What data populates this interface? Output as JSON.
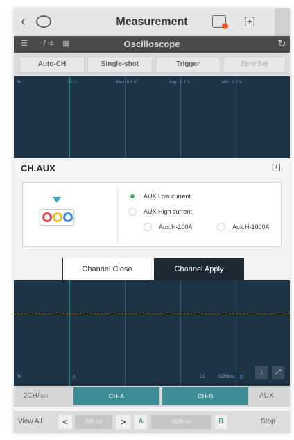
{
  "app": {
    "title": "Measurement",
    "back_icon": "chevron-left-icon",
    "logo_icon": "brand-logo-icon",
    "vci_icon": "vci-status-icon",
    "expand_icon": "fullscreen-icon",
    "more_icon": "more-icon"
  },
  "toolbar": {
    "title": "Oscilloscope",
    "icons": [
      "settings-sliders-icon",
      "measure-icon",
      "chart-icon",
      "refresh-icon"
    ]
  },
  "modes": {
    "auto": "Auto-CH",
    "single": "Single-shot",
    "trigger": "Trigger",
    "zero": "Zero Set"
  },
  "scope_top": {
    "volt_label": "0V",
    "channel_label": "CH-A",
    "max_label": "Max: 0.1 V",
    "avg_label": "Avg: -0.1 V",
    "min_label": "Min: -0.2 V"
  },
  "dialog": {
    "title": "CH.AUX",
    "options": {
      "aux_low": "AUX Low current",
      "aux_high": "AUX High current",
      "h100": "Aux.H-100A",
      "h1000": "Aux.H-1000A"
    },
    "selected": "aux_low",
    "close_label": "Channel Close",
    "apply_label": "Channel Apply",
    "colors": {
      "jack_red": "#e0454f",
      "jack_yellow": "#e6c229",
      "jack_blue": "#3b8fd6",
      "radio_on": "#3fae5a",
      "apply_bg": "#1e2a33"
    }
  },
  "scope_bottom": {
    "volt_label": "0V",
    "marker_a": "A",
    "coupling": "DC",
    "mode": "NORMAL",
    "marker_b": "B"
  },
  "channels": {
    "ch2_main": "2CH/",
    "ch2_sub": "ACH",
    "tab_a": "CH-A",
    "tab_b": "CH-B",
    "aux": "AUX"
  },
  "controls": {
    "view_all": "View All",
    "prev": "<",
    "timebase": "500 us",
    "next": ">",
    "a": "A",
    "position": "4600 us",
    "b": "B",
    "stop": "Stop"
  }
}
